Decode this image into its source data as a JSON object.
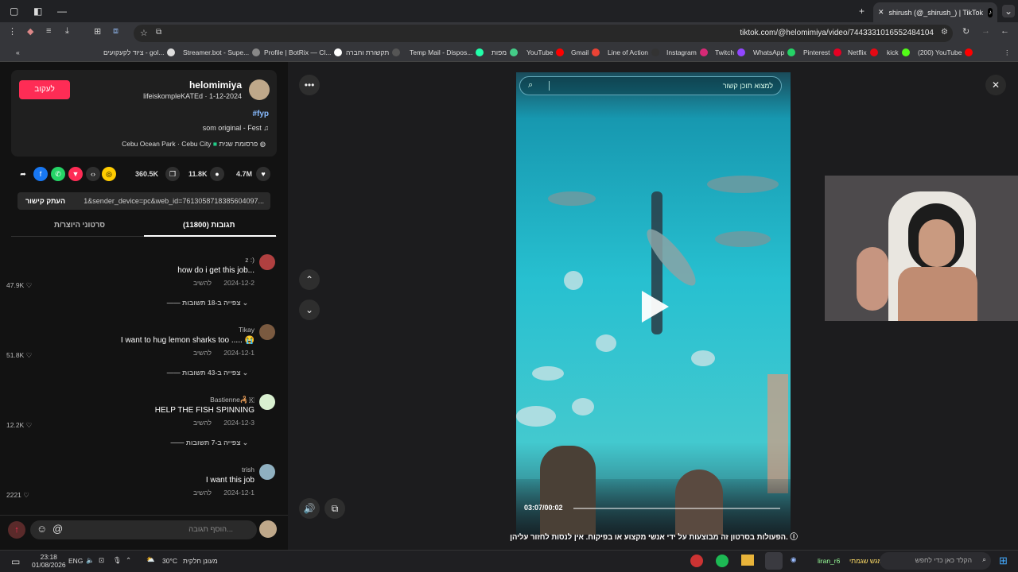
{
  "browser": {
    "tab_title": "shirush (@_shirush_) | TikTok",
    "url": "tiktok.com/@helomimiya/video/7443331016552484104",
    "new_tab": "+",
    "bookmarks": [
      {
        "label": "ציוד לקעקועים - gol...",
        "color": "#ddd"
      },
      {
        "label": "Streamer.bot - Supe...",
        "color": "#888"
      },
      {
        "label": "Profile | BotRix — Cl...",
        "color": "#fff"
      },
      {
        "label": "תקשורת וחברה",
        "color": "#333"
      },
      {
        "label": "Temp Mail - Dispos...",
        "color": "#2fa"
      },
      {
        "label": "מפות",
        "color": "#4c8"
      },
      {
        "label": "YouTube",
        "color": "#f00"
      },
      {
        "label": "Gmail",
        "color": "#ea4335"
      },
      {
        "label": "Line of Action",
        "color": "#333"
      },
      {
        "label": "Instagram",
        "color": "#d62976"
      },
      {
        "label": "Twitch",
        "color": "#9146ff"
      },
      {
        "label": "WhatsApp",
        "color": "#25d366"
      },
      {
        "label": "Pinterest",
        "color": "#e60023"
      },
      {
        "label": "Netflix",
        "color": "#e50914"
      },
      {
        "label": "kick",
        "color": "#53fc18"
      },
      {
        "label": "(200) YouTube",
        "color": "#f00"
      }
    ]
  },
  "post": {
    "follow_label": "לעקוב",
    "username": "helomimiya",
    "nickname_date": "lifeiskompleKATEd · 1-12-2024",
    "hashtag": "#fyp",
    "sound": "som original - Fest",
    "location": "Cebu Ocean Park · Cebu City",
    "promo": "פרסומת שנית",
    "likes": "4.7M",
    "comments": "11.8K",
    "saves": "360.5K",
    "link_text": "1&sender_device=pc&web_id=7613058718385604097...",
    "copy_link": "העתק קישור",
    "tab_comments": "תגובות (11800)",
    "tab_creator": "סרטוני היוצר/ת"
  },
  "comments": [
    {
      "user": "z :)",
      "text": "how do i get this job...",
      "date": "2024-12-2",
      "reply": "להשיב",
      "likes": "47.9K",
      "view": "צפייה ב-18 תשובות",
      "avatar": "#b04040"
    },
    {
      "user": "Tikay",
      "text": "I want to hug lemon sharks too ..... 😭",
      "date": "2024-12-1",
      "reply": "להשיב",
      "likes": "51.8K",
      "view": "צפייה ב-43 תשובות",
      "avatar": "#7a5a40"
    },
    {
      "user": "Bastienne🦂🇰",
      "text": "HELP THE FISH SPINNING",
      "date": "2024-12-3",
      "reply": "להשיב",
      "likes": "12.2K",
      "view": "צפייה ב-7 תשובות",
      "avatar": "#d9f0d0"
    },
    {
      "user": "trish",
      "text": "I want this job",
      "date": "2024-12-1",
      "reply": "להשיב",
      "likes": "2221",
      "view": "",
      "avatar": "#8fb0c0"
    }
  ],
  "composer": {
    "placeholder": "הוסף תגובה..."
  },
  "video": {
    "search_placeholder": "למצוא תוכן קשור",
    "timecode": "03:07/00:02",
    "notice": "הפעולות בסרטון זה מבוצעות על ידי אנשי מקצוע או בפיקוח. אין לנסות לחזור עליהן."
  },
  "taskbar": {
    "time": "23:18",
    "date": "01/08/2026",
    "lang": "ENG",
    "weather": "30°C",
    "weather_text": "מעונן חלקית",
    "search": "הקלד כאן כדי לחפש",
    "chat_user": "liran_r6",
    "chat_text": "מגש שגמתי"
  },
  "icons": [
    "chevron-down-icon",
    "close-icon",
    "back-icon",
    "forward-icon",
    "reload-icon",
    "star-icon",
    "heart-icon",
    "comment-icon",
    "bookmark-icon",
    "share-icon",
    "play-icon",
    "volume-icon",
    "more-icon",
    "up-icon",
    "down-icon",
    "search-icon",
    "emoji-icon",
    "mention-icon",
    "windows-icon"
  ]
}
